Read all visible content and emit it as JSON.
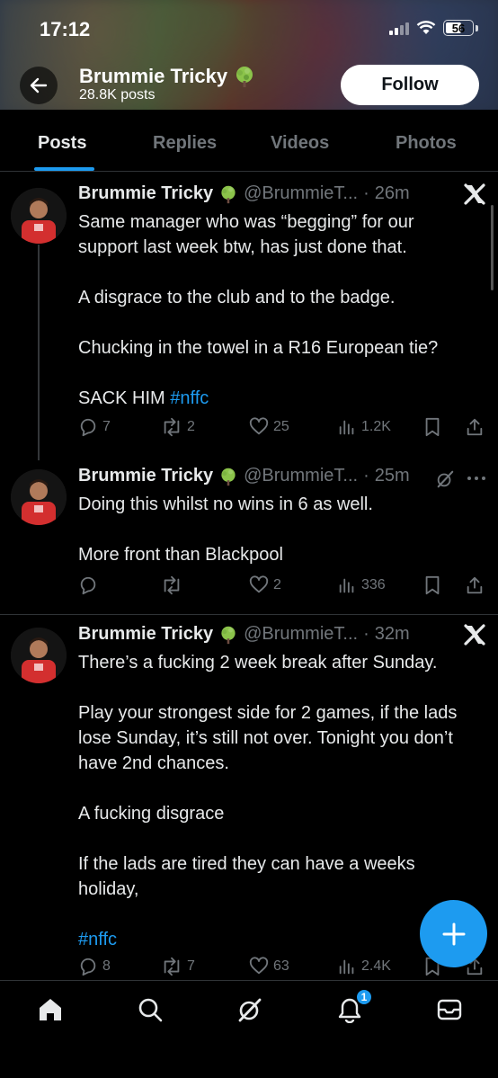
{
  "status_bar": {
    "time": "17:12",
    "battery": "56"
  },
  "profile": {
    "name": "Brummie Tricky",
    "posts": "28.8K posts",
    "follow_label": "Follow"
  },
  "tabs": [
    {
      "label": "Posts",
      "active": true
    },
    {
      "label": "Replies"
    },
    {
      "label": "Videos"
    },
    {
      "label": "Photos"
    }
  ],
  "tweets": [
    {
      "name": "Brummie Tricky",
      "handle": "@BrummieT...",
      "dot": "·",
      "time": "26m",
      "lines": [
        "Same manager who was “begging” for our support last week btw, has just done that.",
        "A disgrace to the club and to the badge.",
        "Chucking in the towel in a R16 European tie?"
      ],
      "last_line_prefix": "SACK HIM ",
      "hashtag": "#nffc",
      "replies": "7",
      "reposts": "2",
      "likes": "25",
      "views": "1.2K"
    },
    {
      "name": "Brummie Tricky",
      "handle": "@BrummieT...",
      "dot": "·",
      "time": "25m",
      "lines": [
        "Doing this whilst no wins in 6 as well.",
        "More front than Blackpool"
      ],
      "replies": "",
      "reposts": "",
      "likes": "2",
      "views": "336"
    },
    {
      "name": "Brummie Tricky",
      "handle": "@BrummieT...",
      "dot": "·",
      "time": "32m",
      "lines": [
        "There’s a fucking 2 week break after Sunday.",
        "Play your strongest side for 2 games, if the lads lose Sunday, it’s still not over. Tonight you don’t have 2nd chances.",
        "A fucking disgrace",
        "If the lads are tired they can have a weeks holiday,"
      ],
      "hashtag": "#nffc",
      "replies": "8",
      "reposts": "7",
      "likes": "63",
      "views": "2.4K"
    }
  ],
  "nav": {
    "notifications_badge": "1"
  },
  "colors": {
    "accent": "#1d9bf0",
    "background": "#000000",
    "muted": "#71767b",
    "text": "#e7e9ea"
  },
  "icons": [
    "back-arrow-icon",
    "tree-emoji-icon",
    "x-logo-icon",
    "grok-icon",
    "more-icon",
    "reply-icon",
    "repost-icon",
    "like-icon",
    "views-icon",
    "bookmark-icon",
    "share-icon",
    "plus-icon",
    "home-icon",
    "search-icon",
    "notifications-icon",
    "messages-icon"
  ]
}
